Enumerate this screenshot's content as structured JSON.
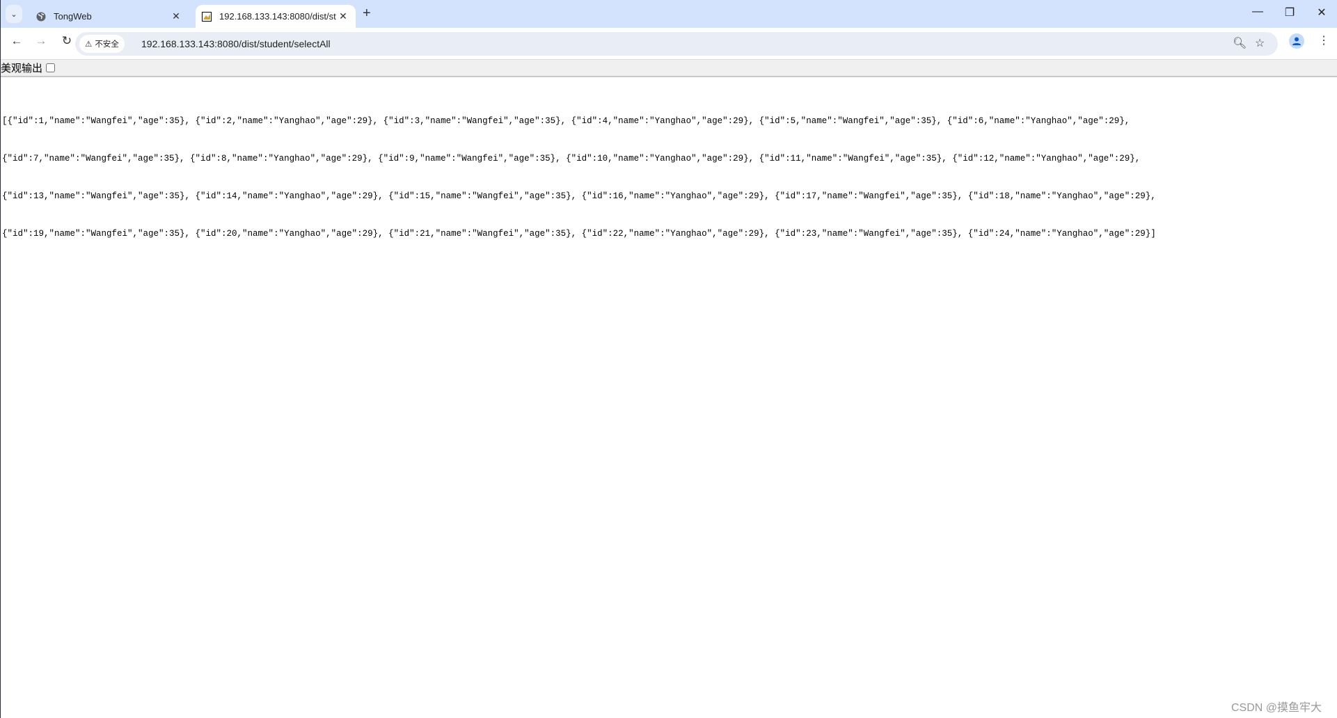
{
  "browser": {
    "tabs": [
      {
        "title": "TongWeb",
        "icon": "globe-icon",
        "active": false
      },
      {
        "title": "192.168.133.143:8080/dist/st",
        "icon": "tomcat-icon",
        "active": true
      }
    ],
    "security_label": "不安全",
    "url": "192.168.133.143:8080/dist/student/selectAll",
    "accent": "#d3e3fd"
  },
  "page": {
    "pretty_print_label": "美观输出",
    "pretty_print_checked": false,
    "json_lines": [
      "[{\"id\":1,\"name\":\"Wangfei\",\"age\":35}, {\"id\":2,\"name\":\"Yanghao\",\"age\":29}, {\"id\":3,\"name\":\"Wangfei\",\"age\":35}, {\"id\":4,\"name\":\"Yanghao\",\"age\":29}, {\"id\":5,\"name\":\"Wangfei\",\"age\":35}, {\"id\":6,\"name\":\"Yanghao\",\"age\":29},",
      "{\"id\":7,\"name\":\"Wangfei\",\"age\":35}, {\"id\":8,\"name\":\"Yanghao\",\"age\":29}, {\"id\":9,\"name\":\"Wangfei\",\"age\":35}, {\"id\":10,\"name\":\"Yanghao\",\"age\":29}, {\"id\":11,\"name\":\"Wangfei\",\"age\":35}, {\"id\":12,\"name\":\"Yanghao\",\"age\":29},",
      "{\"id\":13,\"name\":\"Wangfei\",\"age\":35}, {\"id\":14,\"name\":\"Yanghao\",\"age\":29}, {\"id\":15,\"name\":\"Wangfei\",\"age\":35}, {\"id\":16,\"name\":\"Yanghao\",\"age\":29}, {\"id\":17,\"name\":\"Wangfei\",\"age\":35}, {\"id\":18,\"name\":\"Yanghao\",\"age\":29},",
      "{\"id\":19,\"name\":\"Wangfei\",\"age\":35}, {\"id\":20,\"name\":\"Yanghao\",\"age\":29}, {\"id\":21,\"name\":\"Wangfei\",\"age\":35}, {\"id\":22,\"name\":\"Yanghao\",\"age\":29}, {\"id\":23,\"name\":\"Wangfei\",\"age\":35}, {\"id\":24,\"name\":\"Yanghao\",\"age\":29}]"
    ]
  },
  "watermark": "CSDN @摸鱼牢大"
}
